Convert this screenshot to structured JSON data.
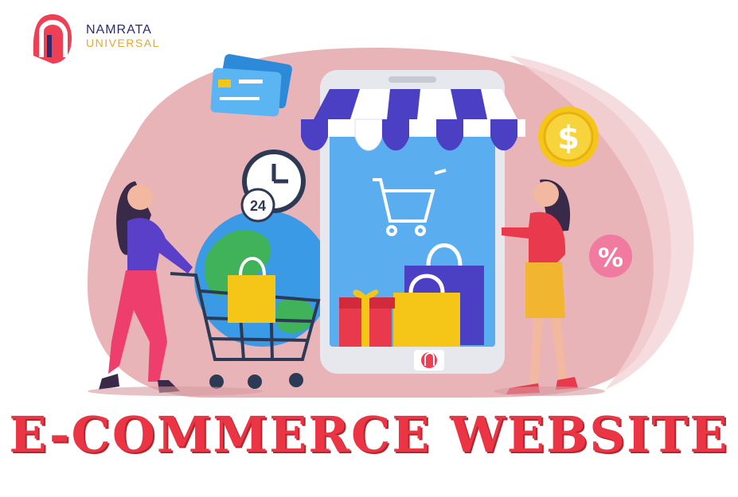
{
  "brand": {
    "name_line1": "NAMRATA",
    "name_line2": "UNIVERSAL"
  },
  "clock": {
    "label": "24"
  },
  "coin": {
    "symbol": "$"
  },
  "discount": {
    "symbol": "%"
  },
  "headline": "E-COMMERCE WEBSITE",
  "colors": {
    "headline": "#ec3544",
    "blob": "#e9b4b8",
    "phone_screen": "#5aaeef",
    "awning_purple": "#4b3fc4",
    "coin": "#f5c518"
  }
}
